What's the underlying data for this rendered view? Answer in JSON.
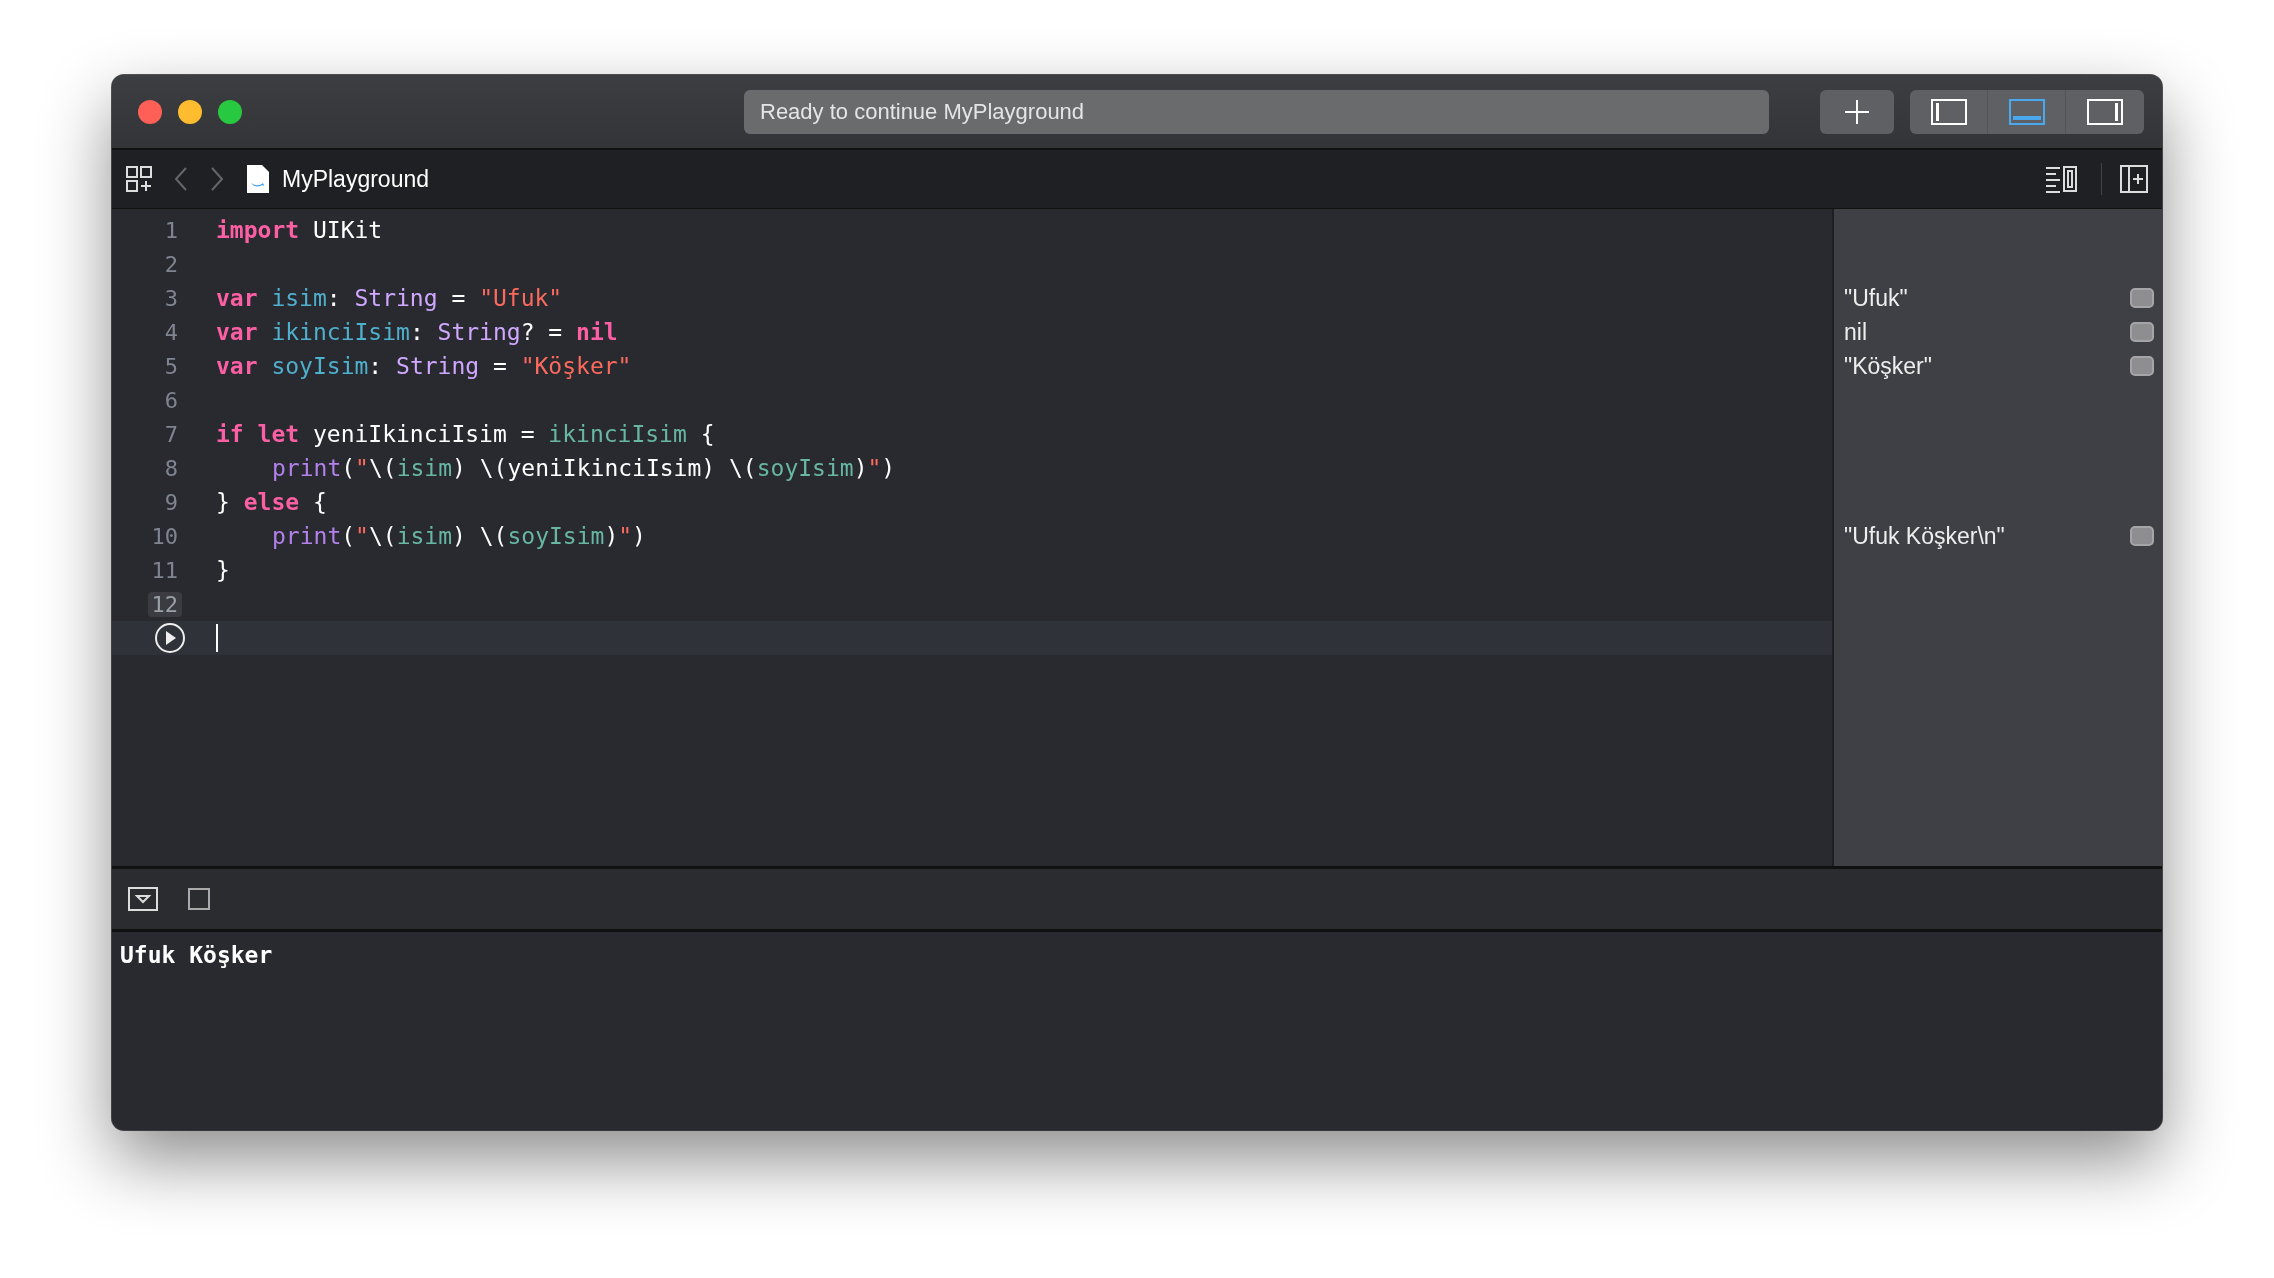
{
  "window": {
    "status": "Ready to continue MyPlayground"
  },
  "toolbar": {
    "layout_toggles": [
      {
        "kind": "navigator",
        "selected": false
      },
      {
        "kind": "debug",
        "selected": true
      },
      {
        "kind": "inspector",
        "selected": false
      }
    ]
  },
  "jump_bar": {
    "file": "MyPlayground"
  },
  "editor": {
    "lines": [
      {
        "number": "1",
        "tokens": [
          {
            "kind": "keyword",
            "text": "import "
          },
          {
            "kind": "plain",
            "text": "UIKit"
          }
        ]
      },
      {
        "number": "2"
      },
      {
        "number": "3",
        "tokens": [
          {
            "kind": "keyword",
            "text": "var "
          },
          {
            "kind": "decl",
            "text": "isim"
          },
          {
            "kind": "plain",
            "text": ": "
          },
          {
            "kind": "type",
            "text": "String"
          },
          {
            "kind": "plain",
            "text": " = "
          },
          {
            "kind": "string",
            "text": "\"Ufuk\""
          }
        ],
        "result": "\"Ufuk\""
      },
      {
        "number": "4",
        "tokens": [
          {
            "kind": "keyword",
            "text": "var "
          },
          {
            "kind": "decl",
            "text": "ikinciIsim"
          },
          {
            "kind": "plain",
            "text": ": "
          },
          {
            "kind": "type",
            "text": "String"
          },
          {
            "kind": "plain",
            "text": "? = "
          },
          {
            "kind": "keyword",
            "text": "nil"
          }
        ],
        "result": "nil"
      },
      {
        "number": "5",
        "tokens": [
          {
            "kind": "keyword",
            "text": "var "
          },
          {
            "kind": "decl",
            "text": "soyIsim"
          },
          {
            "kind": "plain",
            "text": ": "
          },
          {
            "kind": "type",
            "text": "String"
          },
          {
            "kind": "plain",
            "text": " = "
          },
          {
            "kind": "string",
            "text": "\"Köşker\""
          }
        ],
        "result": "\"Köşker\""
      },
      {
        "number": "6"
      },
      {
        "number": "7",
        "tokens": [
          {
            "kind": "keyword",
            "text": "if let "
          },
          {
            "kind": "plain",
            "text": "yeniIkinciIsim = "
          },
          {
            "kind": "var",
            "text": "ikinciIsim"
          },
          {
            "kind": "plain",
            "text": " {"
          }
        ]
      },
      {
        "number": "8",
        "indent": true,
        "tokens": [
          {
            "kind": "func",
            "text": "print"
          },
          {
            "kind": "plain",
            "text": "("
          },
          {
            "kind": "string",
            "text": "\""
          },
          {
            "kind": "plain",
            "text": "\\("
          },
          {
            "kind": "var",
            "text": "isim"
          },
          {
            "kind": "plain",
            "text": ") \\(yeniIkinciIsim) \\("
          },
          {
            "kind": "var",
            "text": "soyIsim"
          },
          {
            "kind": "plain",
            "text": ")"
          },
          {
            "kind": "string",
            "text": "\""
          },
          {
            "kind": "plain",
            "text": ")"
          }
        ]
      },
      {
        "number": "9",
        "tokens": [
          {
            "kind": "plain",
            "text": "} "
          },
          {
            "kind": "keyword",
            "text": "else"
          },
          {
            "kind": "plain",
            "text": " {"
          }
        ]
      },
      {
        "number": "10",
        "indent": true,
        "tokens": [
          {
            "kind": "func",
            "text": "print"
          },
          {
            "kind": "plain",
            "text": "("
          },
          {
            "kind": "string",
            "text": "\""
          },
          {
            "kind": "plain",
            "text": "\\("
          },
          {
            "kind": "var",
            "text": "isim"
          },
          {
            "kind": "plain",
            "text": ") \\("
          },
          {
            "kind": "var",
            "text": "soyIsim"
          },
          {
            "kind": "plain",
            "text": ")"
          },
          {
            "kind": "string",
            "text": "\""
          },
          {
            "kind": "plain",
            "text": ")"
          }
        ],
        "result": "\"Ufuk Köşker\\n\""
      },
      {
        "number": "11",
        "tokens": [
          {
            "kind": "plain",
            "text": "}"
          }
        ]
      },
      {
        "number": "12",
        "highlighted": true
      },
      {
        "kind": "run",
        "current": true
      }
    ]
  },
  "console": {
    "output": "Ufuk Köşker"
  }
}
